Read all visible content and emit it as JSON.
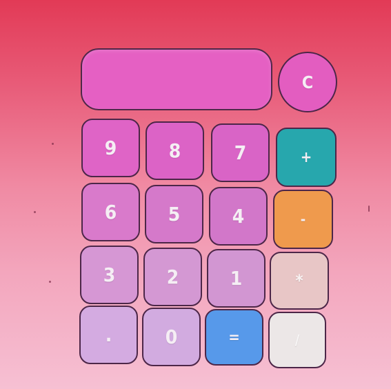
{
  "calculator": {
    "display_value": "",
    "clear_label": "C",
    "keys": {
      "k9": "9",
      "k8": "8",
      "k7": "7",
      "plus": "+",
      "k6": "6",
      "k5": "5",
      "k4": "4",
      "minus": "-",
      "k3": "3",
      "k2": "2",
      "k1": "1",
      "multiply": "*",
      "decimal": ".",
      "k0": "0",
      "equals": "=",
      "divide": "/"
    }
  },
  "colors": {
    "background_top": "#e23a56",
    "background_bottom": "#f6c0d3",
    "display": "#e560c3",
    "plus_key": "#27a7ad",
    "minus_key": "#ef9a4d",
    "equals_key": "#5799ea",
    "multiply_key": "#e8c6c6",
    "divide_key": "#ece7e7"
  }
}
